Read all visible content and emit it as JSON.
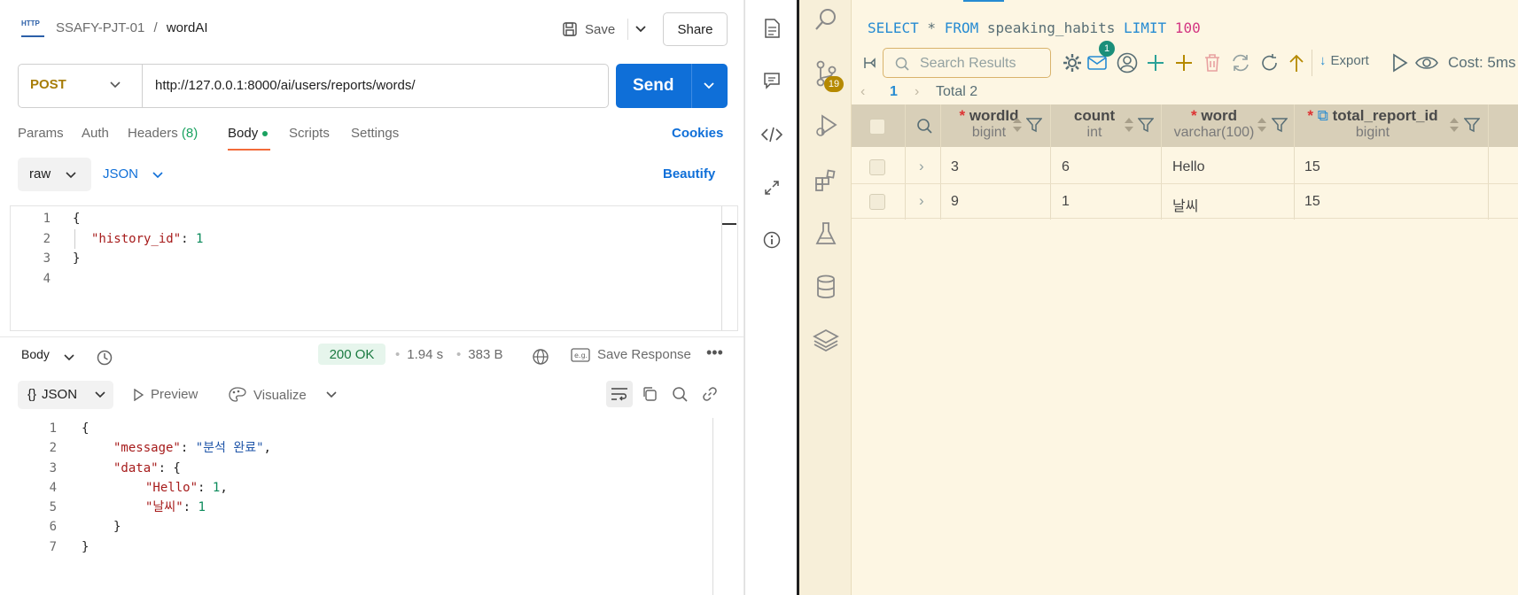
{
  "app": {
    "crumb_workspace": "SSAFY-PJT-01",
    "crumb_sep": "/",
    "crumb_request": "wordAI",
    "save_label": "Save",
    "share_label": "Share",
    "http_icon_text": "HTTP"
  },
  "request": {
    "method": "POST",
    "url": "http://127.0.0.1:8000/ai/users/reports/words/",
    "send_label": "Send",
    "tabs": {
      "params": "Params",
      "auth": "Auth",
      "headers": "Headers",
      "headers_count": "(8)",
      "body": "Body",
      "scripts": "Scripts",
      "settings": "Settings"
    },
    "cookies_label": "Cookies",
    "body_mode": "raw",
    "body_format": "JSON",
    "beautify_label": "Beautify",
    "lines": [
      "1",
      "2",
      "3",
      "4"
    ],
    "code": {
      "l1": "{",
      "l2_key": "\"history_id\"",
      "l2_colon": ": ",
      "l2_val": "1",
      "l3": "}"
    }
  },
  "response": {
    "body_label": "Body",
    "status": "200 OK",
    "time": "1.94 s",
    "size": "383 B",
    "save_response_label": "Save Response",
    "format": "JSON",
    "format_prefix": "{}",
    "preview_label": "Preview",
    "visualize_label": "Visualize",
    "lines": [
      "1",
      "2",
      "3",
      "4",
      "5",
      "6",
      "7"
    ],
    "code": {
      "l1": "{",
      "l2_key": "\"message\"",
      "l2_val": "\"분석 완료\"",
      "l3_key": "\"data\"",
      "l3_rest": ": {",
      "l4_key": "\"Hello\"",
      "l4_val": "1",
      "l5_key": "\"날씨\"",
      "l5_val": "1",
      "l6": "}",
      "l7": "}"
    }
  },
  "db": {
    "sql_kw_select": "SELECT",
    "sql_star": " * ",
    "sql_kw_from": "FROM",
    "sql_table": " speaking_habits ",
    "sql_kw_limit": "LIMIT",
    "sql_limit": " 100",
    "search_placeholder": "Search Results",
    "notif_count": "1",
    "scm_count": "19",
    "export_label": "Export",
    "cost_label": "Cost: 5ms",
    "page": "1",
    "total": "Total 2",
    "columns": [
      {
        "name": "wordId",
        "type": "bigint",
        "required": "*"
      },
      {
        "name": "count",
        "type": "int",
        "required": ""
      },
      {
        "name": "word",
        "type": "varchar(100)",
        "required": "*"
      },
      {
        "name": "total_report_id",
        "type": "bigint",
        "required": "*"
      }
    ],
    "rows": [
      {
        "wordId": "3",
        "count": "6",
        "word": "Hello",
        "total_report_id": "15"
      },
      {
        "wordId": "9",
        "count": "1",
        "word": "날씨",
        "total_report_id": "15"
      }
    ]
  }
}
